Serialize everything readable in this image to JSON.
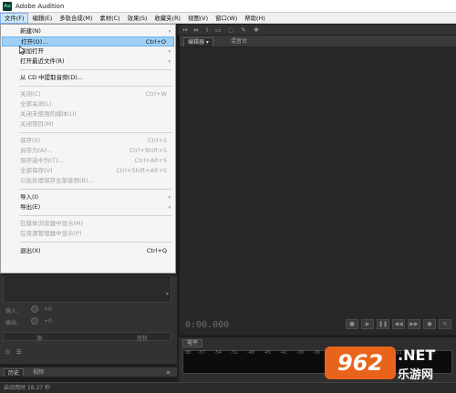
{
  "window": {
    "title": "Adobe Audition",
    "app_icon": "Au"
  },
  "menubar": [
    {
      "label": "文件(F)",
      "active": true
    },
    {
      "label": "编辑(E)"
    },
    {
      "label": "多轨合成(M)"
    },
    {
      "label": "素材(C)"
    },
    {
      "label": "效果(S)"
    },
    {
      "label": "收藏夹(R)"
    },
    {
      "label": "视图(V)"
    },
    {
      "label": "窗口(W)"
    },
    {
      "label": "帮助(H)"
    }
  ],
  "file_menu": {
    "new": {
      "label": "新建(N)"
    },
    "open": {
      "label": "打开(O)...",
      "shortcut": "Ctrl+O"
    },
    "open_append": {
      "label": "追加打开"
    },
    "open_recent": {
      "label": "打开最近文件(R)"
    },
    "extract_cd": {
      "label": "从 CD 中提取音频(D)..."
    },
    "close": {
      "label": "关闭(C)",
      "shortcut": "Ctrl+W"
    },
    "close_all": {
      "label": "全部关闭(L)"
    },
    "close_unused": {
      "label": "关闭未使用的媒体(U)"
    },
    "close_session": {
      "label": "关闭项目(M)"
    },
    "save": {
      "label": "保存(S)",
      "shortcut": "Ctrl+S"
    },
    "save_as": {
      "label": "另存为(A)...",
      "shortcut": "Ctrl+Shift+S"
    },
    "save_selection": {
      "label": "保存选中为(T)...",
      "shortcut": "Ctrl+Alt+S"
    },
    "save_all": {
      "label": "全部保存(V)",
      "shortcut": "Ctrl+Shift+Alt+S"
    },
    "save_all_batch": {
      "label": "以批处理保存全部音频(B)..."
    },
    "import": {
      "label": "导入(I)"
    },
    "export": {
      "label": "导出(E)"
    },
    "reveal_browser": {
      "label": "在媒体浏览器中显示(M)"
    },
    "reveal_explorer": {
      "label": "在资源管理器中显示(P)"
    },
    "exit": {
      "label": "退出(X)",
      "shortcut": "Ctrl+Q"
    }
  },
  "editor": {
    "tabs": [
      {
        "label": "编辑器"
      },
      {
        "label": "混音台"
      }
    ],
    "time": "0:00.000"
  },
  "left_panel": {
    "input_label": "输入:",
    "output_label": "输出:",
    "value_zero_1": "+0",
    "value_zero_2": "+0",
    "side_label": "源:",
    "track_label": "音轨"
  },
  "bottom_tabs": [
    {
      "label": "历史"
    },
    {
      "label": "视频"
    }
  ],
  "levels": {
    "tab": "电平",
    "ticks": [
      "dB",
      "-57",
      "-54",
      "-51",
      "-48",
      "-45",
      "-42",
      "-39",
      "-36",
      "-33",
      "-30",
      "-27",
      "-24",
      "-21",
      "-18",
      "-15"
    ]
  },
  "status": {
    "text": "启动用时 18.27 秒"
  },
  "watermark": {
    "number": "962",
    "domain": ".NET",
    "cn": "乐游网"
  }
}
